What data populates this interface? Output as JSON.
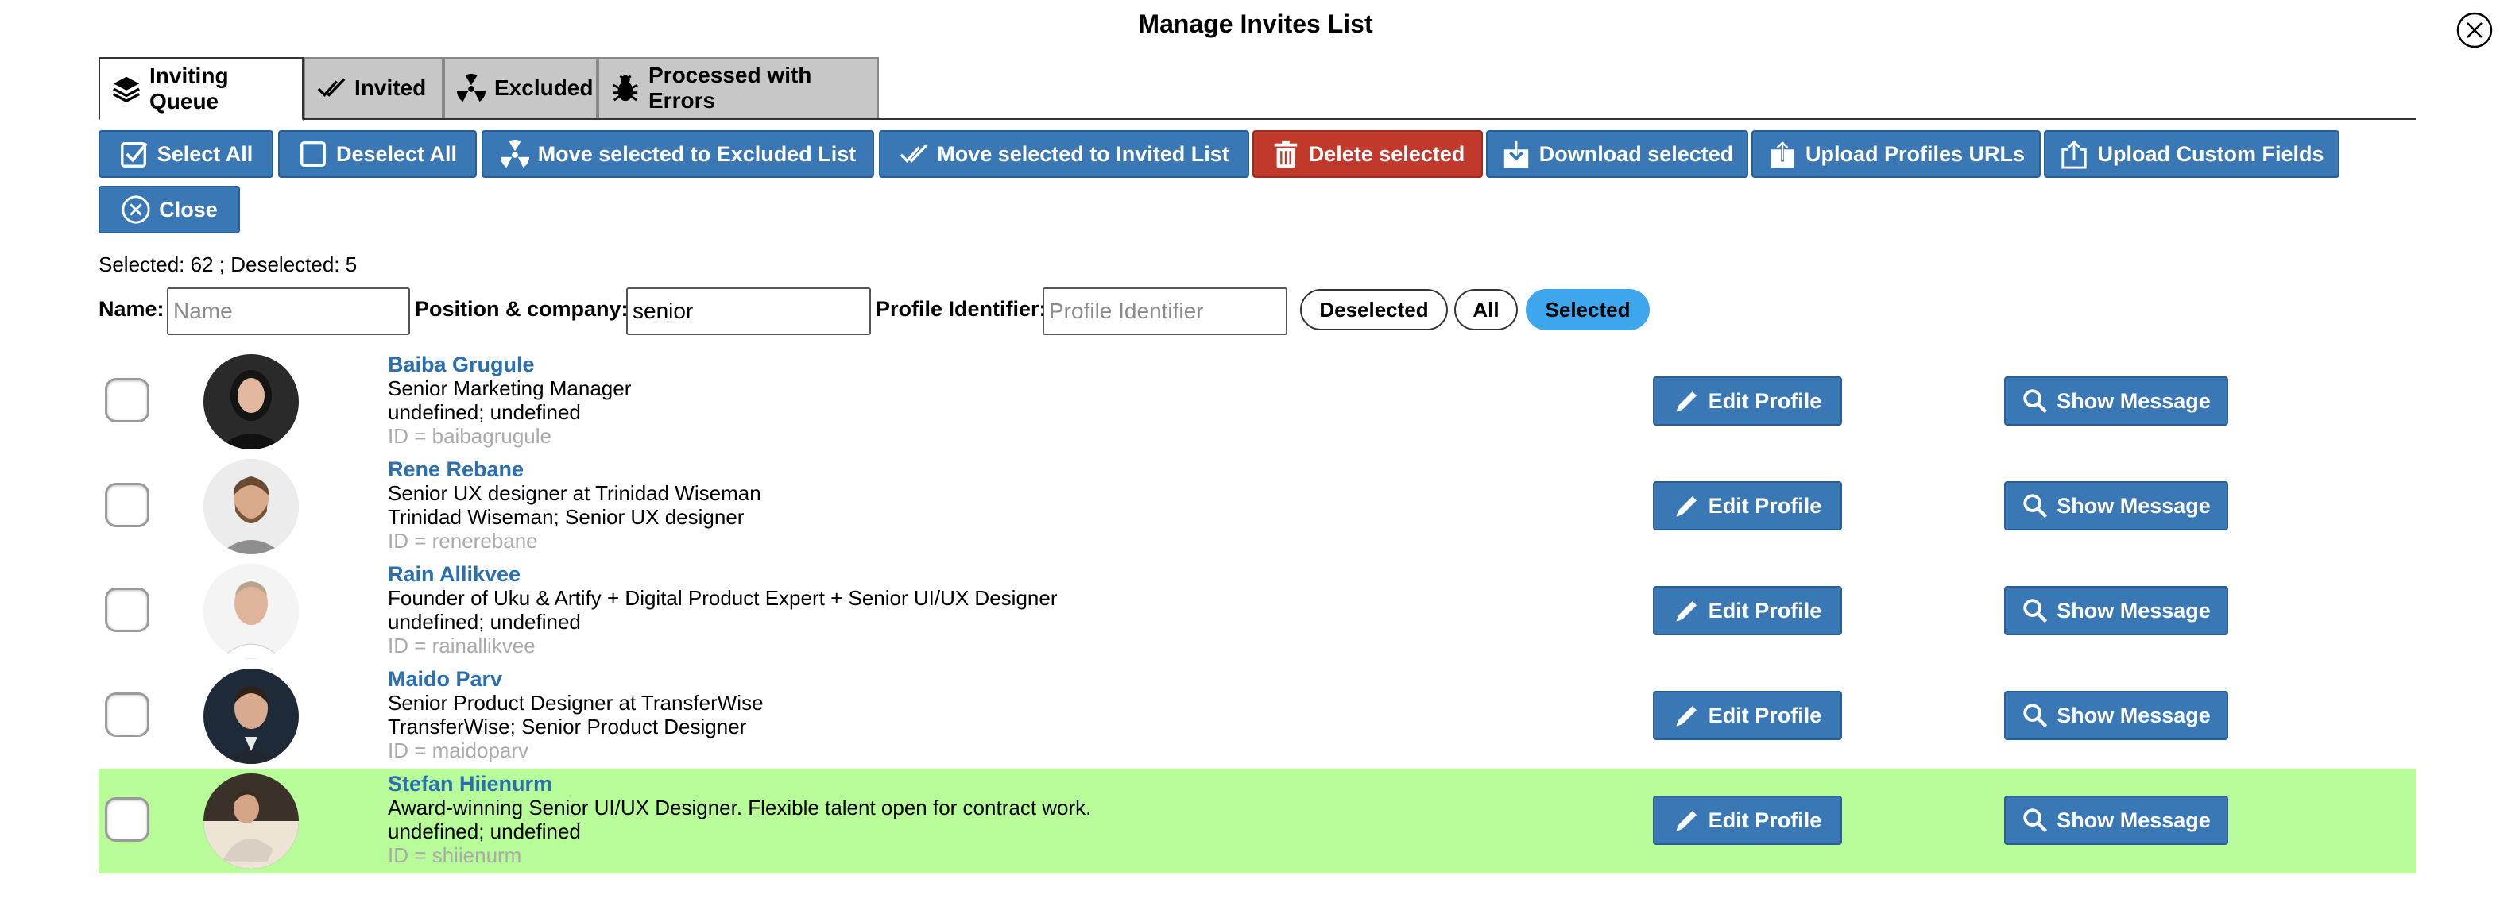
{
  "window": {
    "title": "Manage Invites List"
  },
  "tabs": [
    {
      "label": "Inviting Queue",
      "icon": "layers-icon",
      "active": true
    },
    {
      "label": "Invited",
      "icon": "double-check-icon",
      "active": false
    },
    {
      "label": "Excluded",
      "icon": "radiation-icon",
      "active": false
    },
    {
      "label": "Processed with Errors",
      "icon": "bug-icon",
      "active": false
    }
  ],
  "toolbar": {
    "select_all": "Select All",
    "deselect_all": "Deselect All",
    "move_excluded": "Move selected to Excluded List",
    "move_invited": "Move selected to Invited List",
    "delete_selected": "Delete selected",
    "download_selected": "Download selected",
    "upload_urls": "Upload Profiles URLs",
    "upload_custom": "Upload Custom Fields",
    "close": "Close"
  },
  "counts": {
    "text": "Selected: 62 ; Deselected: 5"
  },
  "filters": {
    "name_label": "Name:",
    "name_placeholder": "Name",
    "name_value": "",
    "position_label": "Position & company:",
    "position_placeholder": "",
    "position_value": "senior",
    "identifier_label": "Profile Identifier:",
    "identifier_placeholder": "Profile Identifier",
    "identifier_value": "",
    "pill_deselected": "Deselected",
    "pill_all": "All",
    "pill_selected": "Selected",
    "active_pill": "Selected"
  },
  "row_actions": {
    "edit": "Edit Profile",
    "show": "Show Message"
  },
  "profiles": [
    {
      "name": "Baiba Grugule",
      "headline": "Senior Marketing Manager",
      "company": "undefined; undefined",
      "id": "ID = baibagrugule",
      "highlighted": false
    },
    {
      "name": "Rene Rebane",
      "headline": "Senior UX designer at Trinidad Wiseman",
      "company": "Trinidad Wiseman; Senior UX designer",
      "id": "ID = renerebane",
      "highlighted": false
    },
    {
      "name": "Rain Allikvee",
      "headline": "Founder of Uku & Artify + Digital Product Expert + Senior UI/UX Designer",
      "company": "undefined; undefined",
      "id": "ID = rainallikvee",
      "highlighted": false
    },
    {
      "name": "Maido Parv",
      "headline": "Senior Product Designer at TransferWise",
      "company": "TransferWise; Senior Product Designer",
      "id": "ID = maidoparv",
      "highlighted": false
    },
    {
      "name": "Stefan Hiienurm",
      "headline": "Award-winning Senior UI/UX Designer. Flexible talent open for contract work.",
      "company": "undefined; undefined",
      "id": "ID = shiienurm",
      "highlighted": true
    }
  ],
  "colors": {
    "button_blue": "#3a78b5",
    "delete_red": "#c0392b",
    "highlight_green": "#b7fc99",
    "selected_pill": "#3ea6ec",
    "name_link": "#2a6fb0"
  }
}
